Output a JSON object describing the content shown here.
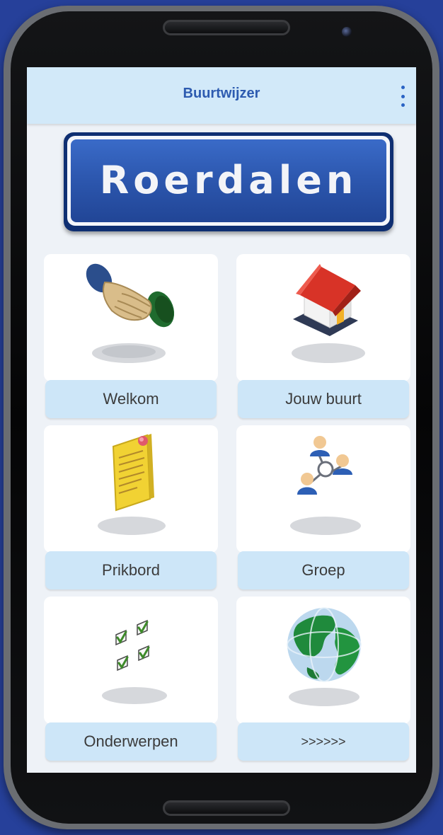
{
  "appbar": {
    "title": "Buurtwijzer",
    "menu_icon": "more-vert-icon"
  },
  "sign": {
    "text": "Roerdalen"
  },
  "tiles": [
    {
      "label": "Welkom",
      "icon": "handshake-icon"
    },
    {
      "label": "Jouw buurt",
      "icon": "house-icon"
    },
    {
      "label": "Prikbord",
      "icon": "notice-board-icon"
    },
    {
      "label": "Groep",
      "icon": "group-icon"
    },
    {
      "label": "Onderwerpen",
      "icon": "checklist-icon"
    },
    {
      "label": ">>>>>>",
      "icon": "globe-icon"
    }
  ],
  "colors": {
    "background": "#26409a",
    "appbar": "#d2e9f9",
    "title": "#2d5bb0",
    "sign_blue": "#2d58b0",
    "tile_label_bg": "#cde6f8"
  }
}
